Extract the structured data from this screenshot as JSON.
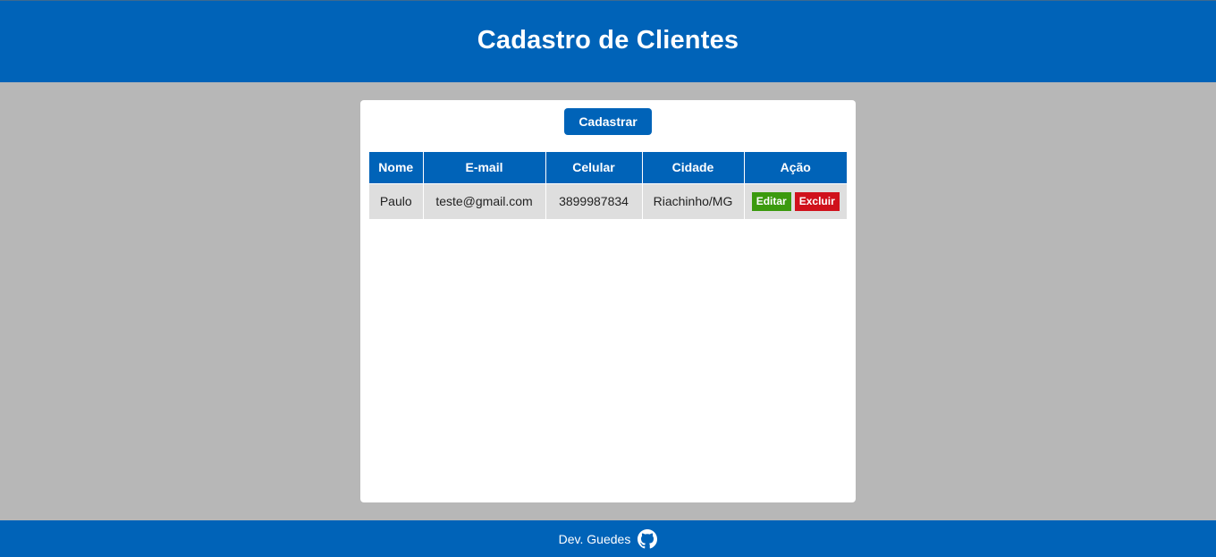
{
  "header": {
    "title": "Cadastro de Clientes"
  },
  "card": {
    "register_label": "Cadastrar",
    "table": {
      "columns": [
        "Nome",
        "E-mail",
        "Celular",
        "Cidade",
        "Ação"
      ],
      "rows": [
        {
          "nome": "Paulo",
          "email": "teste@gmail.com",
          "celular": "3899987834",
          "cidade": "Riachinho/MG",
          "edit_label": "Editar",
          "delete_label": "Excluir"
        }
      ]
    }
  },
  "footer": {
    "credit": "Dev. Guedes",
    "icon": "github-icon"
  },
  "colors": {
    "primary": "#0063b8",
    "background": "#b7b7b7",
    "edit": "#3b9a0e",
    "delete": "#d0111b"
  }
}
